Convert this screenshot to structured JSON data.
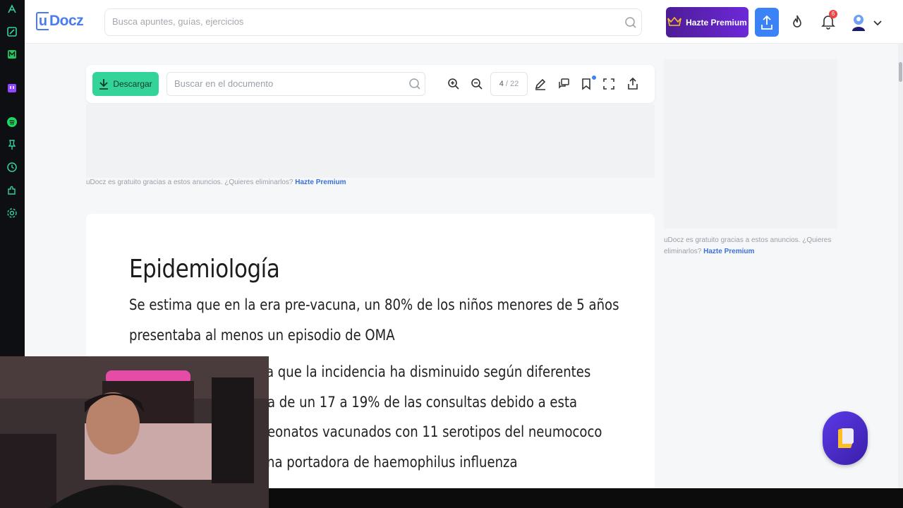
{
  "brand": {
    "name": "Docz",
    "letter": "u",
    "color": "#4a7cf0"
  },
  "header": {
    "search_placeholder": "Busca apuntes, guías, ejercicios",
    "premium_label": "Hazte Premium",
    "notification_count": "6"
  },
  "toolbar": {
    "download_label": "Descargar",
    "search_placeholder": "Buscar en el documento",
    "page_current": "4",
    "page_separator": "/",
    "page_total": "22"
  },
  "ads": {
    "notice_text": "uDocz es gratuito gracias a estos anuncios. ¿Quieres eliminarlos?",
    "notice_link": "Hazte Premium",
    "side_notice_line1": "uDocz es gratuito gracias a estos anuncios. ¿Quieres",
    "side_notice_line2": "eliminarlos?",
    "side_notice_link": "Hazte Premium"
  },
  "document": {
    "title": "Epidemiología",
    "lines": [
      "Se estima que en la era pre-vacuna, un 80% de los niños menores de 5 años",
      "presentaba al menos un episodio de OMA",
      "a que la incidencia ha disminuido según diferentes",
      "a de un 17 a 19% de las consultas debido a esta",
      "eonatos vacunados con 11 serotipos del neumococo",
      "na portadora de haemophilus influenza"
    ]
  },
  "colors": {
    "premium": "#5b21b6",
    "upload": "#3b82f6",
    "download": "#34d399",
    "sidepanel": "#0e0f12",
    "float_button": "#4c2fd0"
  }
}
